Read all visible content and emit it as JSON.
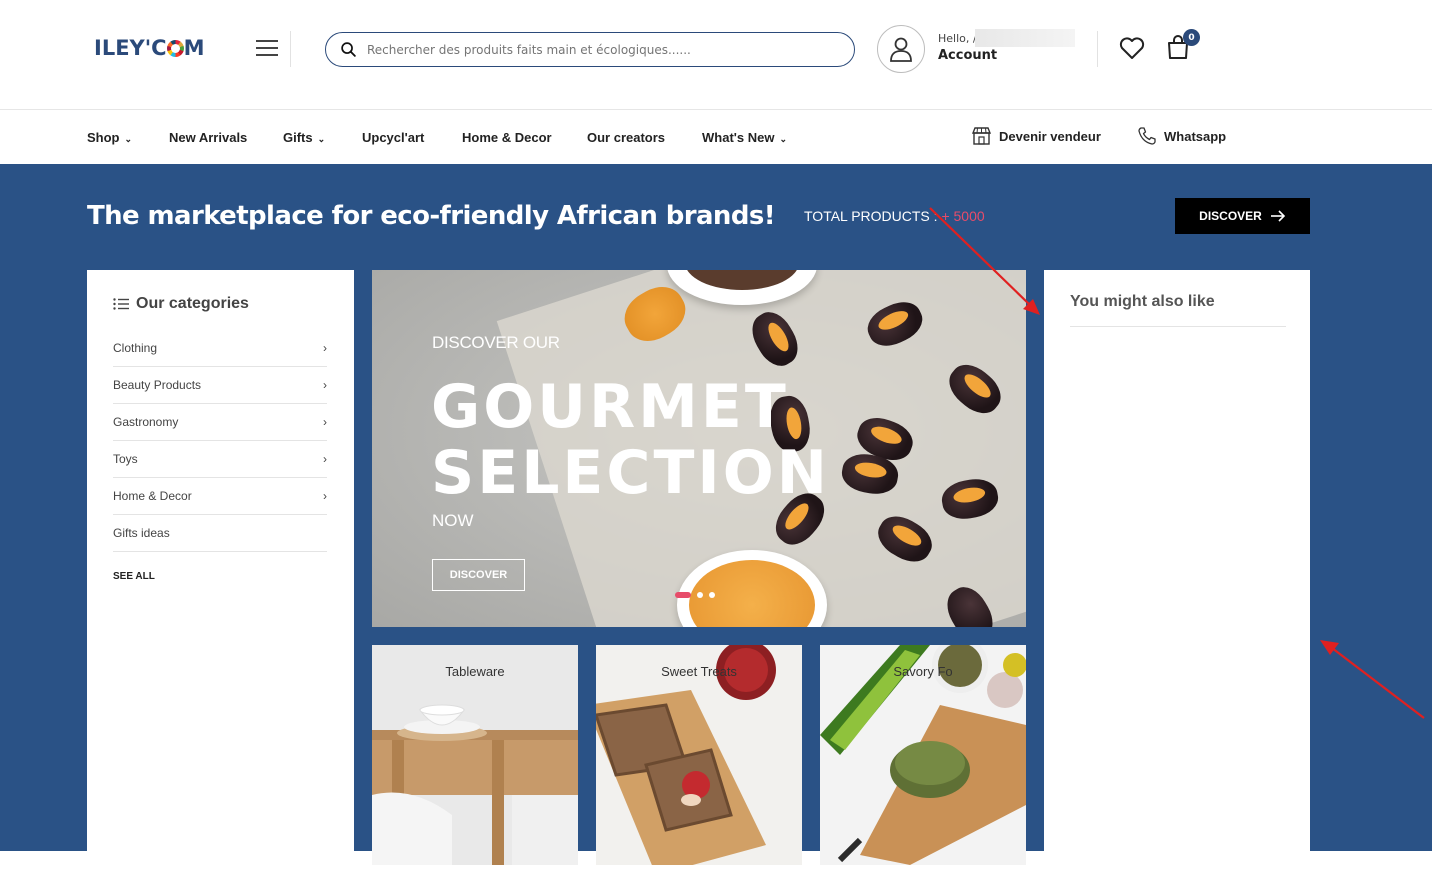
{
  "header": {
    "logo_text": "ILEY'C",
    "logo_tail": "M",
    "search_placeholder": "Rechercher des produits faits main et écologiques......",
    "hello": "Hello, /",
    "account": "Account",
    "cart_count": "0"
  },
  "nav": {
    "items": [
      {
        "label": "Shop",
        "dropdown": true
      },
      {
        "label": "New Arrivals",
        "dropdown": false
      },
      {
        "label": "Gifts",
        "dropdown": true
      },
      {
        "label": "Upcycl'art",
        "dropdown": false
      },
      {
        "label": "Home & Decor",
        "dropdown": false
      },
      {
        "label": "Our creators",
        "dropdown": false
      },
      {
        "label": "What's New",
        "dropdown": true
      }
    ],
    "seller": "Devenir vendeur",
    "whatsapp": "Whatsapp"
  },
  "hero": {
    "title": "The marketplace for eco-friendly African brands!",
    "total_label": "TOTAL PRODUCTS : ",
    "total_value": "+ 5000",
    "discover": "DISCOVER"
  },
  "categories": {
    "heading": "Our categories",
    "items": [
      {
        "label": "Clothing",
        "has_children": true
      },
      {
        "label": "Beauty Products",
        "has_children": true
      },
      {
        "label": "Gastronomy",
        "has_children": true
      },
      {
        "label": "Toys",
        "has_children": true
      },
      {
        "label": "Home & Decor",
        "has_children": true
      },
      {
        "label": "Gifts ideas",
        "has_children": false
      }
    ],
    "see_all": "SEE ALL"
  },
  "slider": {
    "kicker": "DISCOVER OUR",
    "line1": "GOURMET",
    "line2": "SELECTION",
    "now": "NOW",
    "button": "DISCOVER",
    "dots": 3,
    "active_dot": 1
  },
  "tiles": [
    {
      "label": "Tableware"
    },
    {
      "label": "Sweet Treats"
    },
    {
      "label": "Savory Fo"
    }
  ],
  "sidebar_right": {
    "title": "You might also like"
  },
  "colors": {
    "brand_blue": "#2a5286",
    "accent_pink": "#e74c6a",
    "black": "#000000"
  }
}
